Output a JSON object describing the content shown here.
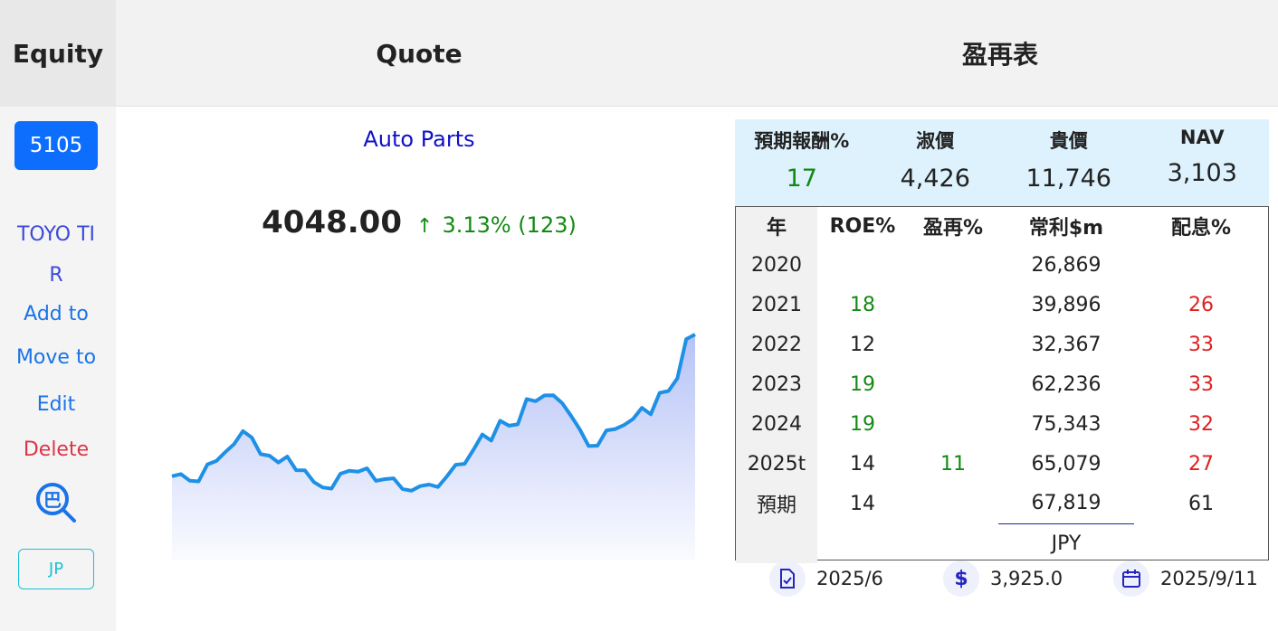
{
  "header": {
    "equity": "Equity",
    "quote": "Quote",
    "table": "盈再表"
  },
  "sidebar": {
    "ticker": "5105",
    "name_line1": "TOYO TI",
    "name_line2": "R",
    "add": "Add to",
    "move": "Move to",
    "edit": "Edit",
    "delete": "Delete",
    "search_glyph": "巴",
    "market": "JP"
  },
  "quote": {
    "sector": "Auto Parts",
    "price": "4048.00",
    "arrow": "↑",
    "change": "3.13% (123)"
  },
  "summary": {
    "labels": [
      "預期報酬%",
      "淑價",
      "貴價",
      "NAV"
    ],
    "values": [
      "17",
      "4,426",
      "11,746",
      "3,103"
    ]
  },
  "table": {
    "headers": [
      "年",
      "ROE%",
      "盈再%",
      "常利$m",
      "配息%"
    ],
    "rows": [
      [
        "2020",
        "",
        "",
        "26,869",
        ""
      ],
      [
        "2021",
        "18",
        "",
        "39,896",
        "26"
      ],
      [
        "2022",
        "12",
        "",
        "32,367",
        "33"
      ],
      [
        "2023",
        "19",
        "",
        "62,236",
        "33"
      ],
      [
        "2024",
        "19",
        "",
        "75,343",
        "32"
      ],
      [
        "2025t",
        "14",
        "11",
        "65,079",
        "27"
      ],
      [
        "預期",
        "14",
        "",
        "67,819",
        "61"
      ]
    ],
    "currency": "JPY"
  },
  "footer": {
    "date1": "2025/6",
    "price": "3,925.0",
    "date2": "2025/9/11",
    "dollar_icon": "$"
  },
  "colors": {
    "accent": "#0d6efd",
    "up": "#138a13",
    "down": "#e02020",
    "line": "#1e90e6"
  },
  "chart_data": {
    "type": "area",
    "title": "",
    "xlabel": "",
    "ylabel": "",
    "values": [
      49.6,
      50.9,
      47.0,
      46.6,
      56.6,
      58.6,
      63.8,
      68.5,
      76.2,
      72.4,
      62.6,
      61.7,
      57.7,
      61.2,
      53.2,
      53.1,
      46.2,
      43.0,
      42.3,
      51.1,
      52.8,
      52.3,
      54.3,
      46.9,
      47.9,
      48.4,
      42.1,
      41.1,
      43.8,
      44.7,
      43.3,
      49.5,
      56.4,
      56.9,
      65.2,
      74.2,
      70.6,
      82.3,
      79.4,
      80.2,
      95.1,
      93.8,
      97.2,
      97.3,
      92.7,
      85.3,
      77.2,
      67.4,
      67.6,
      76.6,
      77.4,
      79.8,
      83.3,
      89.9,
      86.1,
      98.7,
      99.8,
      107.3,
      130.4,
      133.1
    ]
  }
}
